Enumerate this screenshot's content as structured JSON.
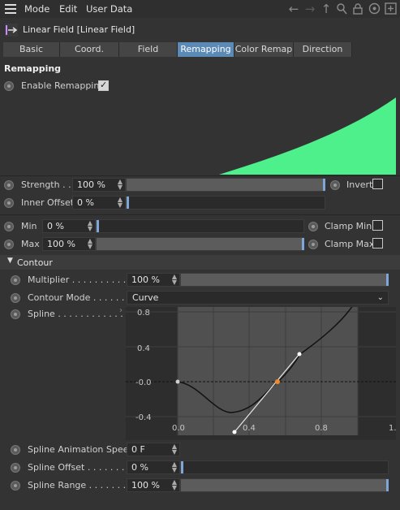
{
  "menubar": {
    "items": [
      "Mode",
      "Edit",
      "User Data"
    ],
    "icons": [
      "hamburger-icon",
      "back-arrow-icon",
      "forward-arrow-icon",
      "up-arrow-icon",
      "search-icon",
      "lock-icon",
      "target-icon",
      "add-icon"
    ]
  },
  "object": {
    "title": "Linear Field [Linear Field]",
    "icon": "linear-field-icon"
  },
  "tabs": [
    {
      "label": "Basic",
      "active": false
    },
    {
      "label": "Coord.",
      "active": false
    },
    {
      "label": "Field",
      "active": false
    },
    {
      "label": "Remapping",
      "active": true
    },
    {
      "label": "Color Remap",
      "active": false
    },
    {
      "label": "Direction",
      "active": false
    }
  ],
  "remapping": {
    "section_title": "Remapping",
    "enable_label": "Enable Remapping",
    "enable_checked": true,
    "preview_color": "#4ef08c",
    "strength": {
      "label": "Strength . .",
      "value": "100 %",
      "fraction": 1.0
    },
    "invert": {
      "label": "Invert",
      "checked": false
    },
    "inner_offset": {
      "label": "Inner Offset",
      "value": "0 %",
      "fraction": 0.0
    },
    "min": {
      "label": "Min",
      "value": "0 %",
      "fraction": 0.0
    },
    "clamp_min": {
      "label": "Clamp Min",
      "checked": false
    },
    "max": {
      "label": "Max",
      "value": "100 %",
      "fraction": 1.0
    },
    "clamp_max": {
      "label": "Clamp Max",
      "checked": false
    }
  },
  "contour": {
    "section_title": "Contour",
    "multiplier": {
      "label": "Multiplier . . . . . . . . . .",
      "value": "100 %",
      "fraction": 1.0
    },
    "contour_mode": {
      "label": "Contour Mode . . . . . .",
      "value": "Curve"
    },
    "spline": {
      "label": "Spline . . . . . . . . . . . . ."
    },
    "spline_graph": {
      "x_ticks": [
        "0.0",
        "0.4",
        "0.8",
        "1."
      ],
      "y_ticks": [
        "0.8",
        "0.4",
        "-0.0",
        "-0.4"
      ]
    },
    "anim_speed": {
      "label": "Spline Animation Speed",
      "value": "0 F"
    },
    "spline_offset": {
      "label": "Spline Offset . . . . . . .",
      "value": "0 %",
      "fraction": 0.0
    },
    "spline_range": {
      "label": "Spline Range . . . . . . . .",
      "value": "100 %",
      "fraction": 1.0
    }
  }
}
